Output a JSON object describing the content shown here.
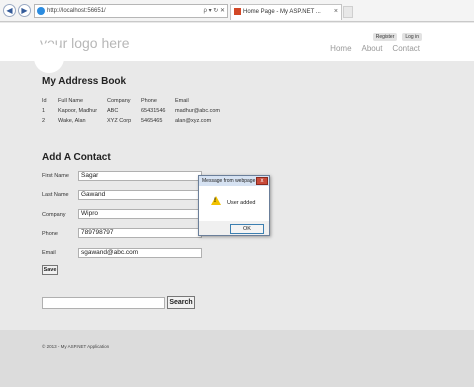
{
  "browser": {
    "address": "http://localhost:56651/",
    "address_tools": "ρ ▾ ↻ ✕",
    "tab_title": "Home Page - My ASP.NET ...",
    "tab_close": "×"
  },
  "header": {
    "logo": "your logo here",
    "login_links": [
      "Register",
      "Log in"
    ],
    "menu": [
      "Home",
      "About",
      "Contact"
    ]
  },
  "address_book": {
    "title": "My Address Book",
    "columns": [
      "Id",
      "Full Name",
      "Company",
      "Phone",
      "Email"
    ],
    "rows": [
      [
        "1",
        "Kapoor, Madhur",
        "ABC",
        "65431546",
        "madhur@abc.com"
      ],
      [
        "2",
        "Wake, Alan",
        "XYZ Corp",
        "5465465",
        "alan@xyz.com"
      ]
    ]
  },
  "add_contact": {
    "title": "Add A Contact",
    "fields": [
      {
        "label": "First Name",
        "value": "Sagar"
      },
      {
        "label": "Last Name",
        "value": "Gawand"
      },
      {
        "label": "Company",
        "value": "Wipro"
      },
      {
        "label": "Phone",
        "value": "789798797"
      },
      {
        "label": "Email",
        "value": "sgawand@abc.com"
      }
    ],
    "save_label": "Save"
  },
  "search": {
    "value": "",
    "button_label": "Search"
  },
  "footer": {
    "text": "© 2013 - My ASP.NET Application"
  },
  "dialog": {
    "title": "Message from webpage",
    "close_label": "x",
    "message": "User added",
    "ok_label": "OK"
  }
}
